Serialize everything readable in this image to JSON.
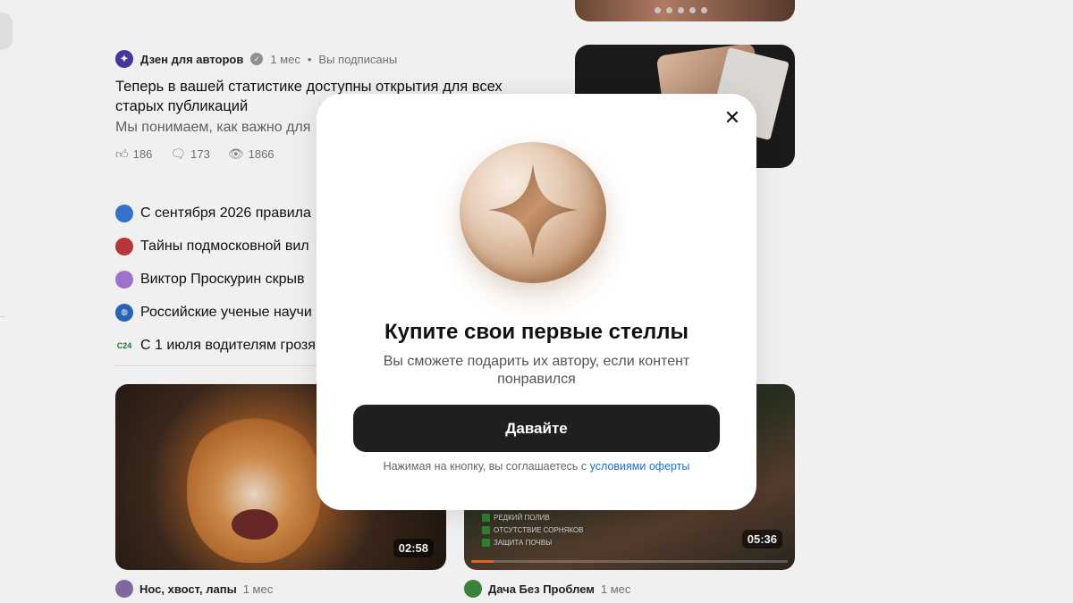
{
  "feed": {
    "post": {
      "author": "Дзен для авторов",
      "avatar_icon": "sparkle-icon",
      "time": "1 мес",
      "subscription": "Вы подписаны",
      "title": "Теперь в вашей статистике доступны открытия для всех старых публикаций",
      "description": "Мы понимаем, как важно для",
      "likes": "186",
      "comments": "173",
      "views": "1866"
    },
    "news": [
      {
        "text": "С сентября 2026 правила",
        "icon_color": "#3a7bd5"
      },
      {
        "text": "Тайны подмосковной вил",
        "icon_color": "#c23b3b"
      },
      {
        "text": "Виктор Проскурин скрыв",
        "icon_color": "#a77ad6"
      },
      {
        "text": "Российские ученые научи",
        "icon_color": "#2a6bbf"
      },
      {
        "text": "С 1 июля водителям грозя",
        "icon_label": "C24",
        "icon_color": "#2c7a3c"
      }
    ],
    "videos": [
      {
        "duration": "02:58",
        "channel": "Нос, хвост, лапы",
        "time": "1 мес",
        "avatar_color": "#8a6ea8"
      },
      {
        "duration": "05:36",
        "channel": "Дача Без Проблем",
        "time": "1 мес",
        "avatar_color": "#3e8a3e",
        "progress_pct": 7,
        "overlay": [
          "РЕДКИЙ ПОЛИВ",
          "ОТСУТСТВИЕ СОРНЯКОВ",
          "ЗАЩИТА ПОЧВЫ"
        ]
      }
    ]
  },
  "modal": {
    "close_icon": "close-icon",
    "coin_icon": "star-coin-icon",
    "title": "Купите свои первые стеллы",
    "subtitle": "Вы сможете подарить их автору, если контент понравился",
    "cta_label": "Давайте",
    "legal_prefix": "Нажимая на кнопку, вы соглашаетесь с",
    "legal_link": "условиями оферты"
  },
  "colors": {
    "cta_bg": "#1f1f21",
    "link": "#1a6fd4",
    "accent_progress": "#f06a1d"
  }
}
